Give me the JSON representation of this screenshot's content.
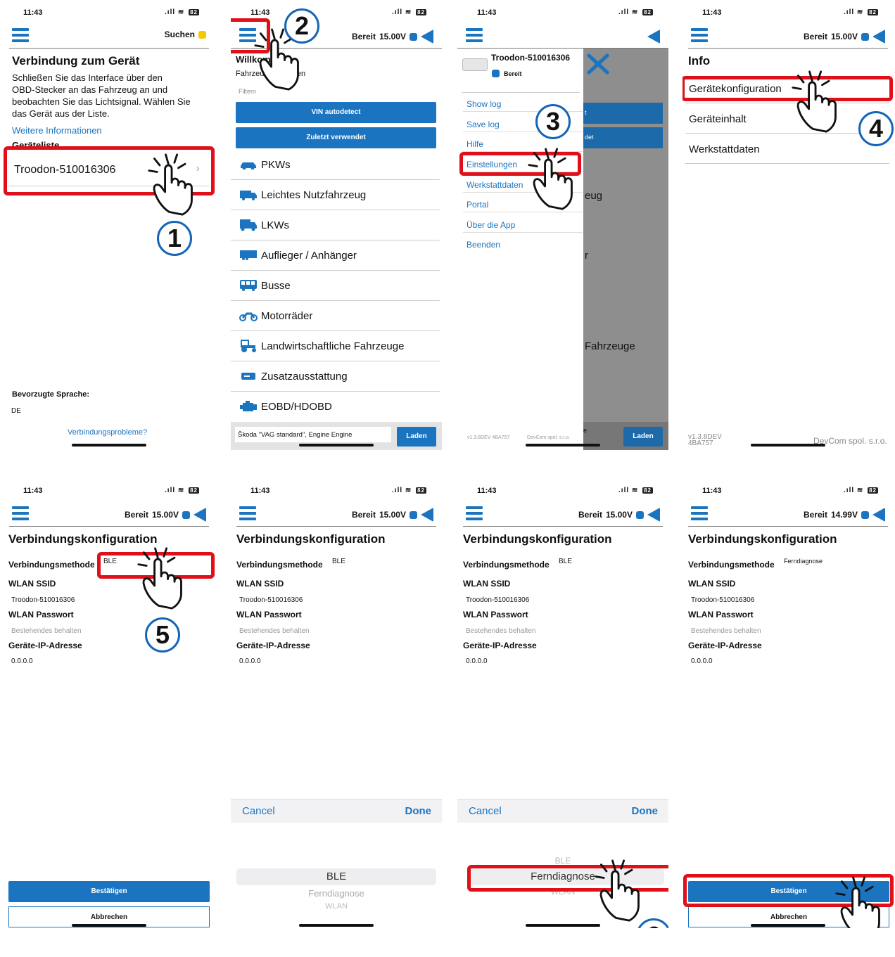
{
  "colors": {
    "accent": "#1a74c0",
    "highlight": "#e0101a",
    "status_yellow": "#f7c700"
  },
  "status": {
    "time": "11:43",
    "battery": "82"
  },
  "screen1": {
    "header_status": "Suchen",
    "title": "Verbindung zum Gerät",
    "desc": [
      "Schließen Sie das Interface über den",
      "OBD-Stecker an das Fahrzeug an und",
      "beobachten Sie das Lichtsignal. Wählen Sie",
      "das Gerät aus der Liste."
    ],
    "more_info": "Weitere Informationen",
    "list_heading": "Geräteliste",
    "device": "Troodon-510016306",
    "chevron": "›",
    "lang_label": "Bevorzugte Sprache:",
    "lang_value": "DE",
    "problems_link": "Verbindungsprobleme?",
    "step": "1"
  },
  "screen2": {
    "status_text": "Bereit",
    "voltage": "15.00V",
    "welcome": "Willkommen",
    "subtitle": "Fahrzeugtyp wählen",
    "filter_placeholder": "Filtern",
    "vin_btn": "VIN autodetect",
    "recent_btn": "Zuletzt verwendet",
    "categories": [
      {
        "label": "PKWs",
        "icon": "car-icon"
      },
      {
        "label": "Leichtes Nutzfahrzeug",
        "icon": "van-icon"
      },
      {
        "label": "LKWs",
        "icon": "truck-icon"
      },
      {
        "label": "Auflieger / Anhänger",
        "icon": "trailer-icon"
      },
      {
        "label": "Busse",
        "icon": "bus-icon"
      },
      {
        "label": "Motorräder",
        "icon": "motorbike-icon"
      },
      {
        "label": "Landwirtschaftliche Fahrzeuge",
        "icon": "tractor-icon"
      },
      {
        "label": "Zusatzausstattung",
        "icon": "equipment-icon"
      },
      {
        "label": "EOBD/HDOBD",
        "icon": "engine-icon"
      }
    ],
    "bottom_input": "Škoda \"VAG standard\", Engine Engine",
    "load_btn": "Laden",
    "step": "2"
  },
  "screen3": {
    "device": "Troodon-510016306",
    "status": "Bereit",
    "menu": [
      "Show log",
      "Save log",
      "Hilfe",
      "Einstellungen",
      "Werkstattdaten",
      "Portal",
      "Über die App",
      "Beenden"
    ],
    "version": "v1.3.8DEV 4BA757",
    "company": "DevCom spol. s.r.o.",
    "bg_partials": {
      "vin": "t",
      "recent": "det",
      "nutz": "eug",
      "auflieger": "r",
      "landw": "Fahrzeuge",
      "bottom": "e"
    },
    "load_btn": "Laden",
    "step": "3"
  },
  "screen4": {
    "status_text": "Bereit",
    "voltage": "15.00V",
    "title": "Info",
    "items": [
      "Gerätekonfiguration",
      "Geräteinhalt",
      "Werkstattdaten"
    ],
    "version": "v1.3.8DEV",
    "version2": "4BA757",
    "company": "DevCom spol. s.r.o.",
    "step": "4"
  },
  "config": {
    "title": "Verbindungskonfiguration",
    "method_label": "Verbindungsmethode",
    "ssid_label": "WLAN SSID",
    "ssid_value": "Troodon-510016306",
    "pw_label": "WLAN Passwort",
    "pw_placeholder": "Bestehendes behalten",
    "ip_label": "Geräte-IP-Adresse",
    "ip_value": "0.0.0.0",
    "confirm": "Bestätigen",
    "cancel_btn": "Abbrechen",
    "picker_cancel": "Cancel",
    "picker_done": "Done",
    "options": [
      "BLE",
      "Ferndiagnose",
      "WLAN"
    ]
  },
  "screen5": {
    "status_text": "Bereit",
    "voltage": "15.00V",
    "method_value": "BLE",
    "step": "5"
  },
  "screen6": {
    "status_text": "Bereit",
    "voltage": "15.00V",
    "method_value": "BLE"
  },
  "screen7": {
    "status_text": "Bereit",
    "voltage": "15.00V",
    "method_value": "BLE",
    "step": "6"
  },
  "screen8": {
    "status_text": "Bereit",
    "voltage": "14.99V",
    "method_value": "Ferndiagnose"
  }
}
